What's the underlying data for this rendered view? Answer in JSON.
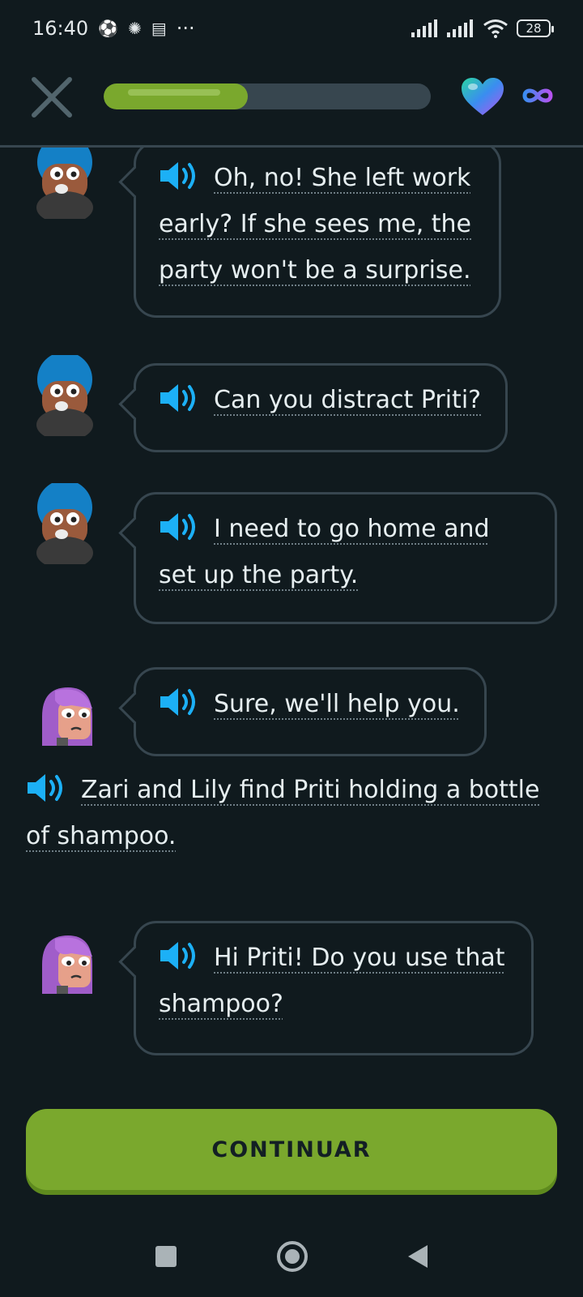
{
  "status_bar": {
    "time": "16:40",
    "left_icons": [
      "soccer-ball-icon",
      "sun-gear-icon",
      "calendar-icon"
    ],
    "more": "···",
    "battery": "28"
  },
  "top_bar": {
    "progress": 0.44,
    "hearts": "infinite",
    "colors": {
      "progress": "#7aa82d",
      "track": "#37464f",
      "speaker": "#1cb0f6"
    }
  },
  "messages": [
    {
      "speaker": "Zari",
      "avatar": "turban-character",
      "text": "Oh, no! She left work early? If she sees me, the party won't be a surprise."
    },
    {
      "speaker": "Zari",
      "avatar": "turban-character",
      "text": "Can you distract Priti?"
    },
    {
      "speaker": "Zari",
      "avatar": "turban-character",
      "text": "I need to go home and set up the party."
    },
    {
      "speaker": "Lily",
      "avatar": "purple-hair-character",
      "text": "Sure, we'll help you."
    }
  ],
  "narration": "Zari and Lily find Priti holding a bottle of shampoo.",
  "last_message": {
    "speaker": "Lily",
    "avatar": "purple-hair-character",
    "text": "Hi Priti! Do you use that shampoo?"
  },
  "continue_button": "CONTINUAR"
}
